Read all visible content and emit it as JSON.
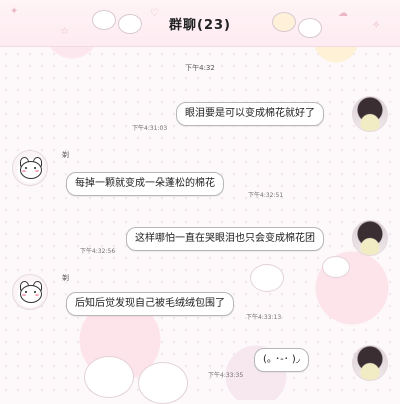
{
  "header": {
    "title": "群聊(23)"
  },
  "chat": {
    "center_time": "下午4:32",
    "messages": [
      {
        "from": "self",
        "text": "眼泪要是可以变成棉花就好了",
        "time": "下午4:31:03"
      },
      {
        "from": "other",
        "sender": "剃",
        "text": "每掉一颗就变成一朵蓬松的棉花",
        "time": "下午4:32:51"
      },
      {
        "from": "self",
        "text": "这样哪怕一直在哭眼泪也只会变成棉花团",
        "time": "下午4:32:56"
      },
      {
        "from": "other",
        "sender": "剃",
        "text": "后知后觉发现自己被毛绒绒包围了",
        "time": "下午4:33:13"
      },
      {
        "from": "self",
        "text": "(｡ ･-･ )◞",
        "time": "下午4:33:35"
      }
    ]
  },
  "colors": {
    "header_bg": "#fdebf1",
    "bubble_border": "#b7b7b7"
  }
}
